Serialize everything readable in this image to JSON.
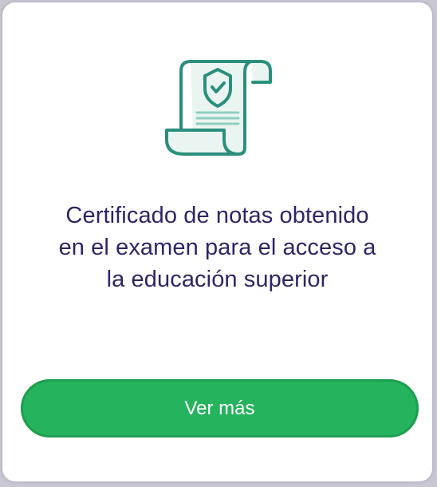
{
  "card": {
    "icon": "certificate-scroll-shield-icon",
    "title_lines": [
      "Certificado de notas obtenido",
      "en el examen para el acceso a",
      "la educación superior"
    ],
    "button_label": "Ver más"
  },
  "colors": {
    "title": "#2e2567",
    "icon_stroke": "#2a8f7c",
    "icon_fill": "#eaf5f2",
    "button": "#26b35d",
    "button_text": "#ffffff",
    "page_background": "#c9c7d2",
    "card_background": "#ffffff"
  }
}
